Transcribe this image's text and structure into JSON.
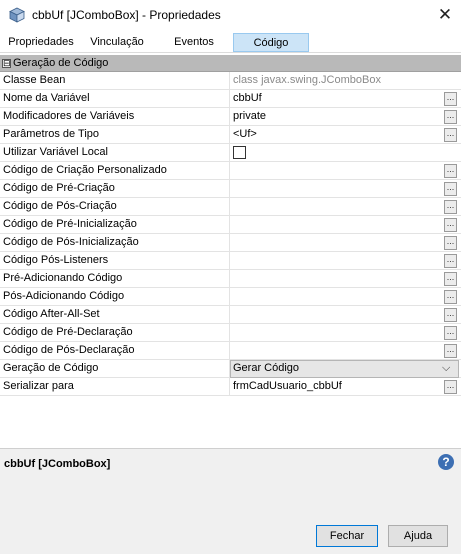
{
  "window": {
    "title": "cbbUf [JComboBox] - Propriedades",
    "icon": "component-cube-icon",
    "close_icon": "close-icon"
  },
  "tabs": [
    {
      "label": "Propriedades",
      "active": false
    },
    {
      "label": "Vinculação",
      "active": false
    },
    {
      "label": "Eventos",
      "active": false
    },
    {
      "label": "Código",
      "active": true
    }
  ],
  "section": {
    "toggle": "⊟",
    "label": "Geração de Código"
  },
  "properties": [
    {
      "name": "Classe Bean",
      "value": "class javax.swing.JComboBox",
      "type": "readonly"
    },
    {
      "name": "Nome da Variável",
      "value": "cbbUf",
      "type": "text"
    },
    {
      "name": "Modificadores de Variáveis",
      "value": "private",
      "type": "text"
    },
    {
      "name": "Parâmetros de Tipo",
      "value": "<Uf>",
      "type": "text"
    },
    {
      "name": "Utilizar Variável Local",
      "value": "",
      "type": "checkbox",
      "checked": false
    },
    {
      "name": "Código de Criação Personalizado",
      "value": "",
      "type": "text"
    },
    {
      "name": "Código de Pré-Criação",
      "value": "",
      "type": "text"
    },
    {
      "name": "Código de Pós-Criação",
      "value": "",
      "type": "text"
    },
    {
      "name": "Código de Pré-Inicialização",
      "value": "",
      "type": "text"
    },
    {
      "name": "Código de Pós-Inicialização",
      "value": "",
      "type": "text"
    },
    {
      "name": "Código Pós-Listeners",
      "value": "",
      "type": "text"
    },
    {
      "name": "Pré-Adicionando Código",
      "value": "",
      "type": "text"
    },
    {
      "name": "Pós-Adicionando Código",
      "value": "",
      "type": "text"
    },
    {
      "name": "Código After-All-Set",
      "value": "",
      "type": "text"
    },
    {
      "name": "Código de Pré-Declaração",
      "value": "",
      "type": "text"
    },
    {
      "name": "Código de Pós-Declaração",
      "value": "",
      "type": "text"
    },
    {
      "name": "Geração de Código",
      "value": "Gerar Código",
      "type": "combo"
    },
    {
      "name": "Serializar para",
      "value": "frmCadUsuario_cbbUf",
      "type": "text"
    }
  ],
  "ellipsis": "...",
  "combo_arrow": "⌵",
  "footer": {
    "description": "cbbUf [JComboBox]",
    "help": "?",
    "ok_label": "Fechar",
    "help_label": "Ajuda"
  }
}
